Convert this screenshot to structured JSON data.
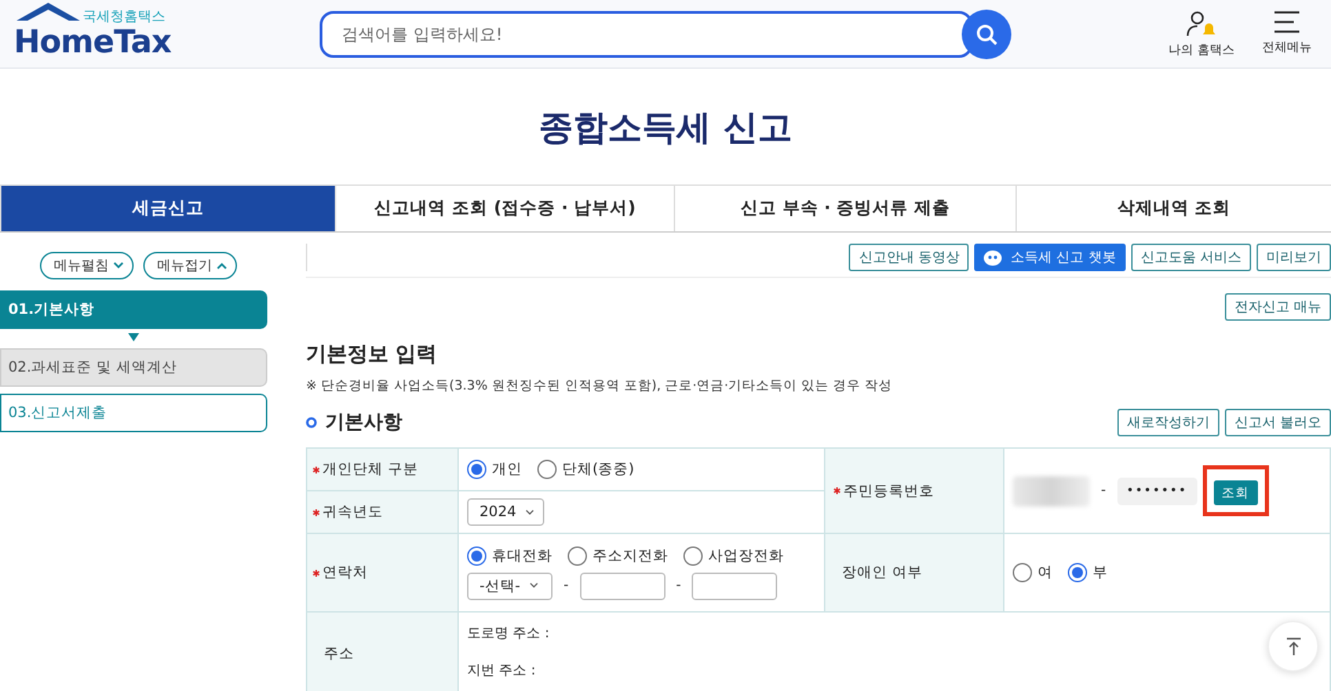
{
  "header": {
    "logo": {
      "subtitle": "국세청홈택스",
      "title": "HomeTax"
    },
    "search": {
      "placeholder": "검색어를 입력하세요!"
    },
    "nav": [
      {
        "kind": "user",
        "label": "나의 홈택스"
      },
      {
        "kind": "menu",
        "label": "전체메뉴"
      }
    ]
  },
  "page_title": "종합소득세 신고",
  "tabs": [
    {
      "label": "세금신고",
      "selected": true
    },
    {
      "label": "신고내역 조회 (접수증 · 납부서)",
      "selected": false
    },
    {
      "label": "신고 부속 · 증빙서류 제출",
      "selected": false
    },
    {
      "label": "삭제내역 조회",
      "selected": false
    }
  ],
  "sidebar": {
    "toggles": [
      {
        "label": "메뉴펼침",
        "kind": "expand"
      },
      {
        "label": "메뉴접기",
        "kind": "collapse"
      }
    ],
    "steps": [
      {
        "label": "01.기본사항",
        "kind": "active"
      },
      {
        "label": "02.과세표준 및 세액계산",
        "kind": "locked"
      },
      {
        "label": "03.신고서제출",
        "kind": "pending"
      }
    ]
  },
  "toolbar": [
    {
      "label": "신고안내 동영상",
      "kind": "outline"
    },
    {
      "label": "소득세 신고 챗봇",
      "kind": "primary"
    },
    {
      "label": "신고도움 서비스",
      "kind": "outline"
    },
    {
      "label": "미리보기",
      "kind": "outline"
    }
  ],
  "manual_button": "전자신고 매뉴",
  "section": {
    "title": "기본정보 입력",
    "note": "※ 단순경비율 사업소득(3.3% 원천징수된 인적용역 포함), 근로·연금·기타소득이 있는 경우 작성",
    "subtitle": "기본사항",
    "actions": [
      "새로작성하기",
      "신고서 불러오"
    ]
  },
  "form": {
    "taxpayer_type": {
      "label": "개인단체 구분",
      "required": true,
      "options": [
        {
          "label": "개인",
          "selected": true
        },
        {
          "label": "단체(종중)",
          "selected": false
        }
      ]
    },
    "year": {
      "label": "귀속년도",
      "required": true,
      "value": "2024"
    },
    "resident_number": {
      "label": "주민등록번호",
      "required": true,
      "separator": "-",
      "second": "•••••••",
      "lookup": {
        "label": "조회",
        "highlighted": true
      }
    },
    "contact": {
      "label": "연락처",
      "required": true,
      "options": [
        {
          "label": "휴대전화",
          "selected": true
        },
        {
          "label": "주소지전화",
          "selected": false
        },
        {
          "label": "사업장전화",
          "selected": false
        }
      ],
      "prefix": "-선택-",
      "separators": [
        "-",
        "-"
      ]
    },
    "disabled": {
      "label": "장애인 여부",
      "required": false,
      "options": [
        {
          "label": "여",
          "selected": false
        },
        {
          "label": "부",
          "selected": true
        }
      ]
    },
    "address": {
      "label": "주소",
      "required": false,
      "lines": [
        "도로명 주소 :",
        "지번 주소 :"
      ]
    }
  }
}
